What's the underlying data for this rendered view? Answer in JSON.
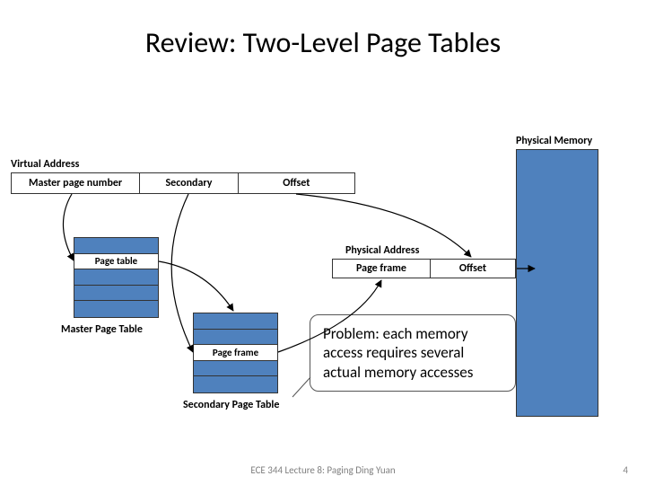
{
  "title": "Review: Two-Level Page Tables",
  "labels": {
    "virtual_address": "Virtual Address",
    "physical_memory": "Physical Memory",
    "physical_address": "Physical Address",
    "master_page_table": "Master Page Table",
    "secondary_page_table": "Secondary Page Table"
  },
  "va": {
    "master": "Master page number",
    "secondary": "Secondary",
    "offset": "Offset"
  },
  "mpt_entry": "Page table",
  "spt_entry": "Page frame",
  "pa": {
    "page_frame": "Page frame",
    "offset": "Offset"
  },
  "callout": "Problem: each memory access requires several actual memory accesses",
  "footer": {
    "center": "ECE 344 Lecture 8: Paging Ding Yuan",
    "page": "4"
  }
}
